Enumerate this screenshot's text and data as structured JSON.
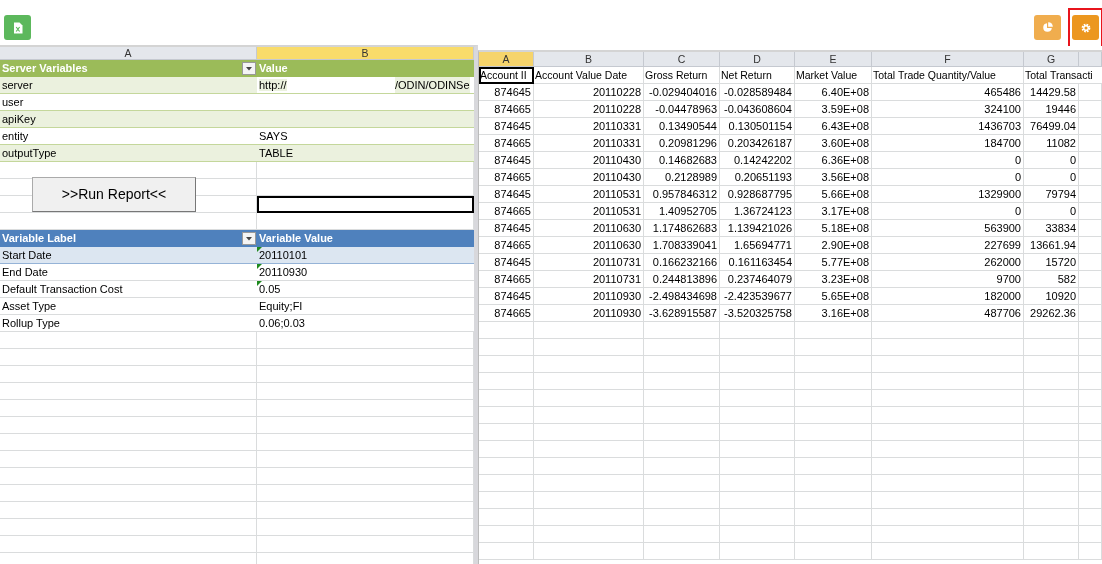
{
  "toolbar": {
    "buttons": [
      {
        "kind": "excel",
        "highlighted": false
      },
      {
        "kind": "chart",
        "highlighted": false
      },
      {
        "kind": "settings",
        "highlighted": true
      }
    ]
  },
  "input_sheet": {
    "columns": [
      {
        "label": "A",
        "selected": false
      },
      {
        "label": "B",
        "selected": true
      }
    ],
    "server_table": {
      "headers": [
        "Server Variables",
        "Value"
      ],
      "rows": [
        {
          "label": "server",
          "value": "http://",
          "value_tail": "/ODIN/ODINSe"
        },
        {
          "label": "user"
        },
        {
          "label": "apiKey"
        },
        {
          "label": "entity",
          "value": "SAYS"
        },
        {
          "label": "outputType",
          "value": "TABLE"
        }
      ]
    },
    "run_button": ">>Run Report<<",
    "variable_table": {
      "headers": [
        "Variable Label",
        "Variable Value"
      ],
      "rows": [
        {
          "label": "Start Date",
          "value": "20110101",
          "flagged": true
        },
        {
          "label": "End Date",
          "value": "20110930",
          "flagged": true
        },
        {
          "label": "Default Transaction Cost",
          "value": "0.05",
          "flagged": true
        },
        {
          "label": "Asset Type",
          "value": "Equity;FI",
          "flagged": false
        },
        {
          "label": "Rollup Type",
          "value": "0.06;0.03",
          "flagged": false
        }
      ]
    }
  },
  "output_sheet": {
    "columns": [
      {
        "label": "A",
        "selected": true
      },
      {
        "label": "B",
        "selected": false
      },
      {
        "label": "C",
        "selected": false
      },
      {
        "label": "D",
        "selected": false
      },
      {
        "label": "E",
        "selected": false
      },
      {
        "label": "F",
        "selected": false
      },
      {
        "label": "G",
        "selected": false
      }
    ],
    "headers": [
      "Account II",
      "Account Value Date",
      "Gross Return",
      "Net Return",
      "Market Value",
      "Total Trade Quantity/Value",
      "Total Transacti"
    ],
    "rows": [
      [
        "874645",
        "20110228",
        "-0.029404016",
        "-0.028589484",
        "6.40E+08",
        "465486",
        "14429.58"
      ],
      [
        "874665",
        "20110228",
        "-0.04478963",
        "-0.043608604",
        "3.59E+08",
        "324100",
        "19446"
      ],
      [
        "874645",
        "20110331",
        "0.13490544",
        "0.130501154",
        "6.43E+08",
        "1436703",
        "76499.04"
      ],
      [
        "874665",
        "20110331",
        "0.20981296",
        "0.203426187",
        "3.60E+08",
        "184700",
        "11082"
      ],
      [
        "874645",
        "20110430",
        "0.14682683",
        "0.14242202",
        "6.36E+08",
        "0",
        "0"
      ],
      [
        "874665",
        "20110430",
        "0.2128989",
        "0.20651193",
        "3.56E+08",
        "0",
        "0"
      ],
      [
        "874645",
        "20110531",
        "0.957846312",
        "0.928687795",
        "5.66E+08",
        "1329900",
        "79794"
      ],
      [
        "874665",
        "20110531",
        "1.40952705",
        "1.36724123",
        "3.17E+08",
        "0",
        "0"
      ],
      [
        "874645",
        "20110630",
        "1.174862683",
        "1.139421026",
        "5.18E+08",
        "563900",
        "33834"
      ],
      [
        "874665",
        "20110630",
        "1.708339041",
        "1.65694771",
        "2.90E+08",
        "227699",
        "13661.94"
      ],
      [
        "874645",
        "20110731",
        "0.166232166",
        "0.161163454",
        "5.77E+08",
        "262000",
        "15720"
      ],
      [
        "874665",
        "20110731",
        "0.244813896",
        "0.237464079",
        "3.23E+08",
        "9700",
        "582"
      ],
      [
        "874645",
        "20110930",
        "-2.498434698",
        "-2.423539677",
        "5.65E+08",
        "182000",
        "10920"
      ],
      [
        "874665",
        "20110930",
        "-3.628915587",
        "-3.520325758",
        "3.16E+08",
        "487706",
        "29262.36"
      ]
    ]
  }
}
